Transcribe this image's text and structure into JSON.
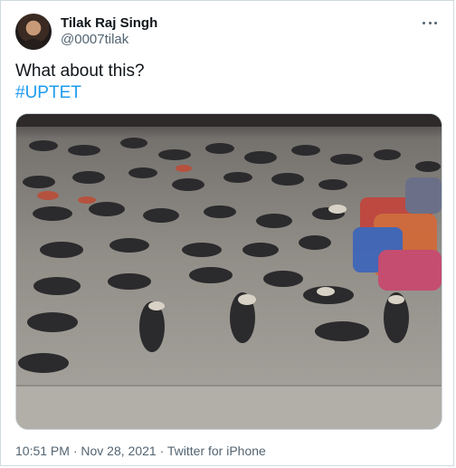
{
  "tweet": {
    "author_name": "Tilak Raj Singh",
    "author_handle": "@0007tilak",
    "text": "What about this?",
    "hashtag": "#UPTET",
    "time": "10:51 PM",
    "separator": "·",
    "date": "Nov 28, 2021",
    "source": "Twitter for iPhone"
  },
  "icons": {
    "more": "more-horizontal-icon"
  },
  "colors": {
    "link": "#1d9bf0",
    "secondary_text": "#536471",
    "border": "#cfd9de"
  }
}
